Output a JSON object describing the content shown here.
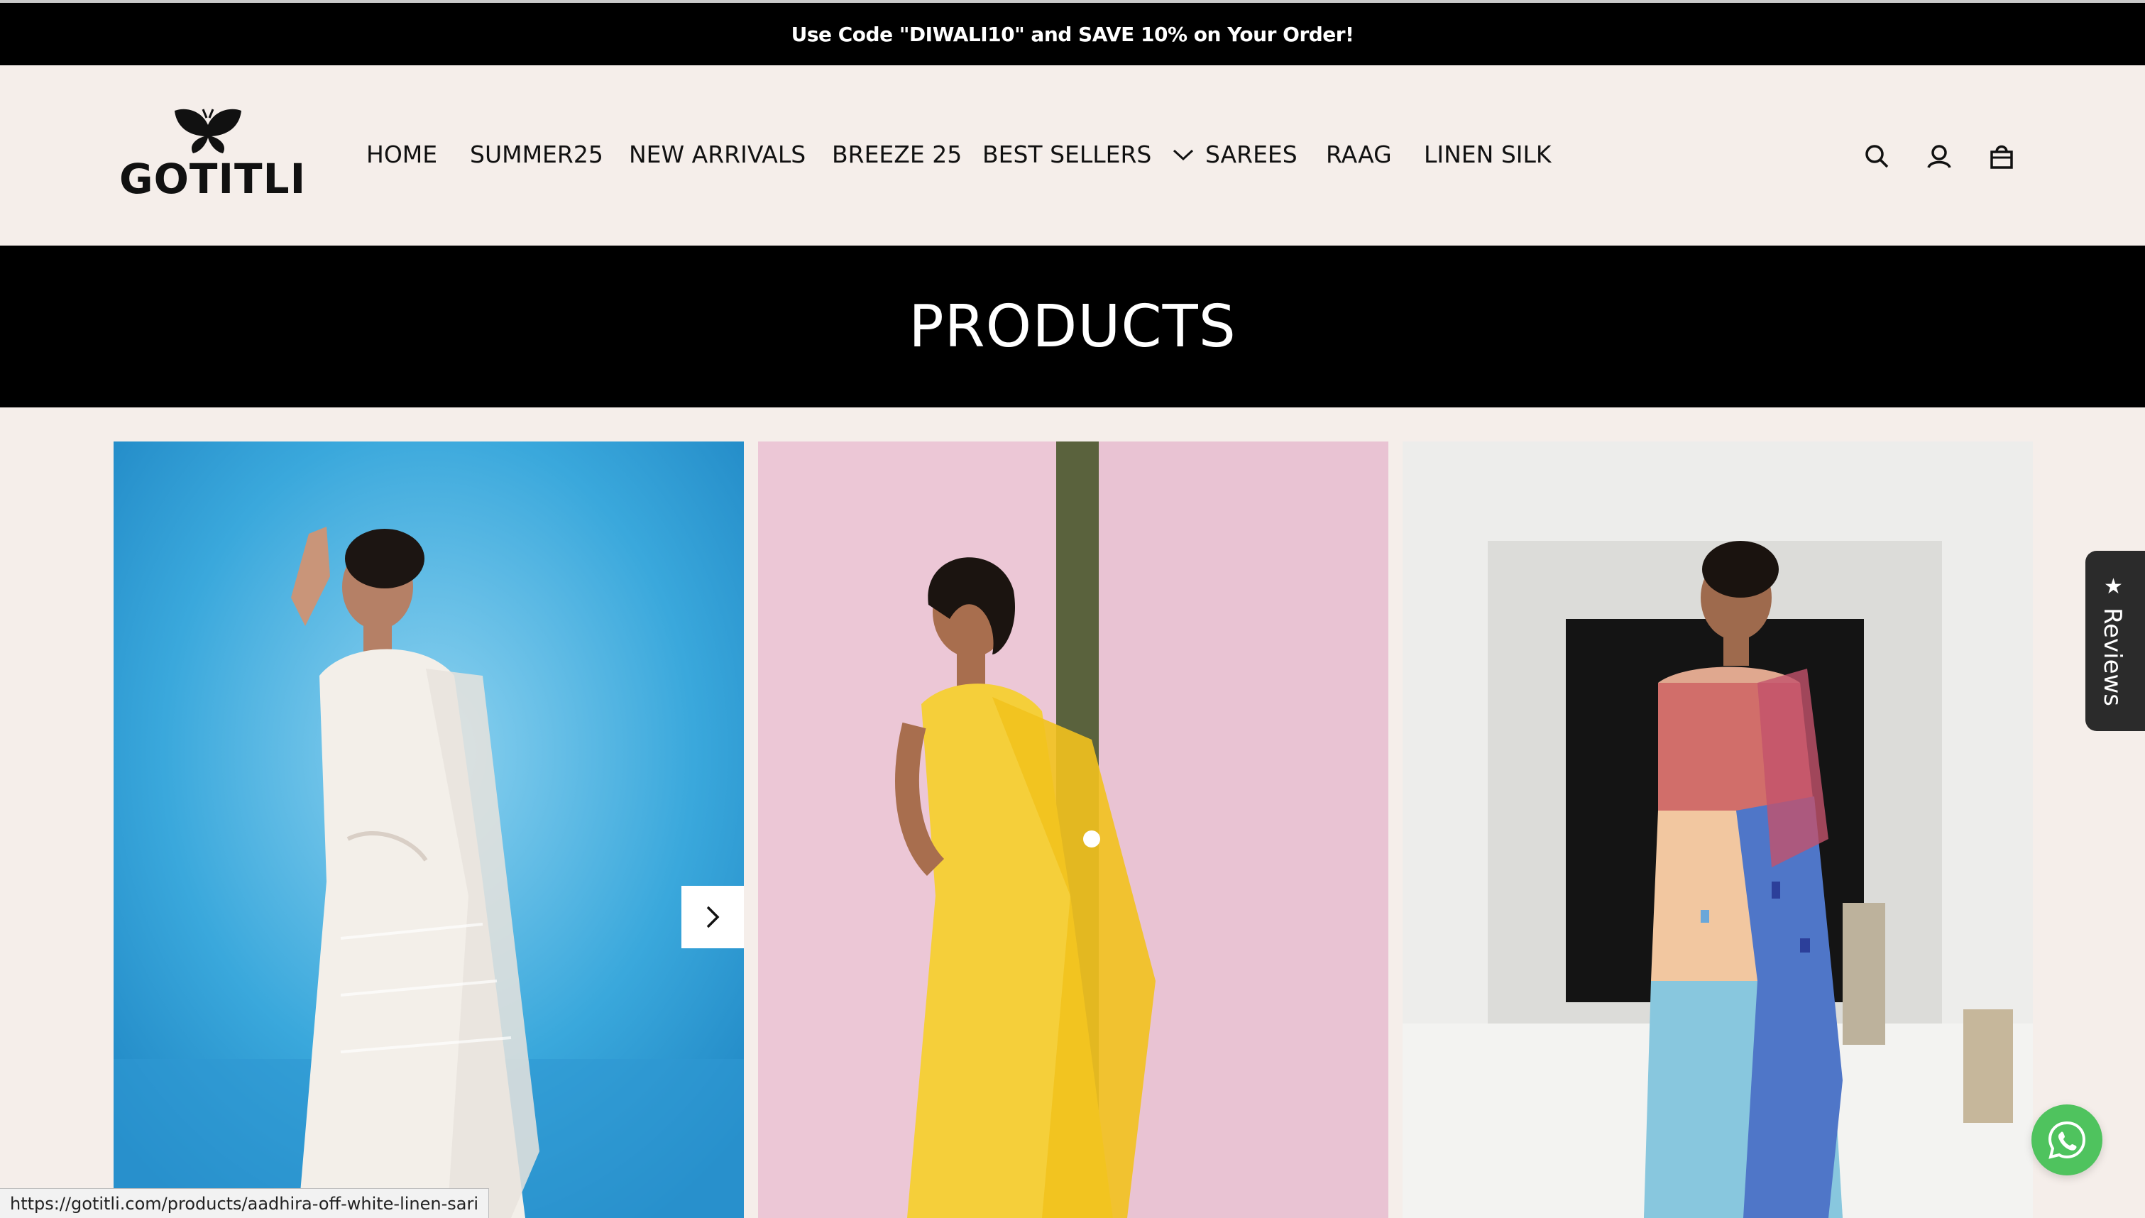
{
  "announcement": {
    "text": "Use Code \"DIWALI10\" and SAVE 10% on Your Order!"
  },
  "header": {
    "logo_text": "GOTITLI",
    "nav": [
      {
        "label": "HOME"
      },
      {
        "label": "SUMMER25"
      },
      {
        "label": "NEW ARRIVALS"
      },
      {
        "label": "BREEZE 25"
      },
      {
        "label": "BEST SELLERS"
      },
      {
        "label": "SAREES",
        "has_dropdown": true
      },
      {
        "label": "RAAG"
      },
      {
        "label": "LINEN SILK"
      }
    ],
    "icons": [
      "search-icon",
      "account-icon",
      "cart-icon"
    ]
  },
  "page": {
    "title": "PRODUCTS"
  },
  "products": [
    {
      "image": "off-white linen saree",
      "accent": "#3aa8dc"
    },
    {
      "image": "yellow saree",
      "accent": "#f2c93c"
    },
    {
      "image": "painted blue-pink saree",
      "accent": "#5f84c9"
    }
  ],
  "widgets": {
    "reviews_label": "Reviews",
    "whatsapp_icon": "whatsapp-icon",
    "carousel_next_icon": "chevron-right-icon"
  },
  "status_bar": {
    "url": "https://gotitli.com/products/aadhira-off-white-linen-sari"
  },
  "colors": {
    "background": "#f5eeea",
    "bar": "#000000",
    "whatsapp": "#4fc35e"
  }
}
